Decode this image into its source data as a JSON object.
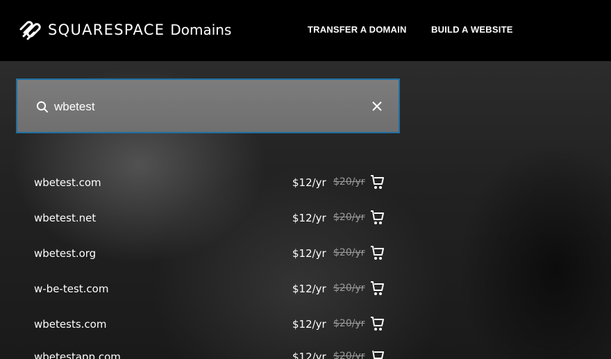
{
  "header": {
    "brand": "SQUARESPACE",
    "brand_sub": "Domains",
    "nav": [
      {
        "label": "TRANSFER A DOMAIN"
      },
      {
        "label": "BUILD A WEBSITE"
      }
    ]
  },
  "search": {
    "value": "wbetest",
    "icon": "search-icon",
    "clear_icon": "close-icon"
  },
  "results": [
    {
      "domain": "wbetest.com",
      "price": "$12/yr",
      "old_price": "$20/yr"
    },
    {
      "domain": "wbetest.net",
      "price": "$12/yr",
      "old_price": "$20/yr"
    },
    {
      "domain": "wbetest.org",
      "price": "$12/yr",
      "old_price": "$20/yr"
    },
    {
      "domain": "w-be-test.com",
      "price": "$12/yr",
      "old_price": "$20/yr"
    },
    {
      "domain": "wbetests.com",
      "price": "$12/yr",
      "old_price": "$20/yr"
    },
    {
      "domain": "wbetestapp.com",
      "price": "$12/yr",
      "old_price": "$20/yr"
    }
  ],
  "colors": {
    "header_bg": "#000000",
    "search_border": "#1f6fa3",
    "old_price": "#9a9a9a"
  }
}
